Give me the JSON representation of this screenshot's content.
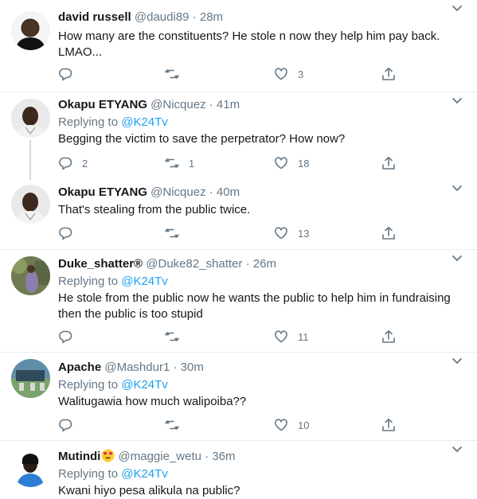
{
  "tweets": [
    {
      "name": "david russell",
      "badge": "",
      "emoji": false,
      "handle": "@daudi89",
      "time": "28m",
      "replying": "",
      "text": "How many are the constituents? He stole n now they help him pay back. LMAO...",
      "replies": "",
      "retweets": "",
      "likes": "3"
    },
    {
      "name": "Okapu ETYANG",
      "badge": "",
      "emoji": false,
      "handle": "@Nicquez",
      "time": "41m",
      "replying": "@K24Tv",
      "text": "Begging the victim to save the perpetrator? How now?",
      "replies": "2",
      "retweets": "1",
      "likes": "18"
    },
    {
      "name": "Okapu ETYANG",
      "badge": "",
      "emoji": false,
      "handle": "@Nicquez",
      "time": "40m",
      "replying": "",
      "text": "That's stealing from the public twice.",
      "replies": "",
      "retweets": "",
      "likes": "13"
    },
    {
      "name": "Duke_shatter",
      "badge": "®",
      "emoji": false,
      "handle": "@Duke82_shatter",
      "time": "26m",
      "replying": "@K24Tv",
      "text": "He stole from the public now he wants the public to help him in fundraising then the public is too stupid",
      "replies": "",
      "retweets": "",
      "likes": "11"
    },
    {
      "name": "Apache",
      "badge": "",
      "emoji": false,
      "handle": "@Mashdur1",
      "time": "30m",
      "replying": "@K24Tv",
      "text": "Walitugawia how much walipoiba??",
      "replies": "",
      "retweets": "",
      "likes": "10"
    },
    {
      "name": "Mutindi",
      "badge": "",
      "emoji": true,
      "handle": "@maggie_wetu",
      "time": "36m",
      "replying": "@K24Tv",
      "text": "Kwani hiyo pesa alikula na public?",
      "replies": "",
      "retweets": "",
      "likes": ""
    }
  ],
  "labels": {
    "replying_prefix": "Replying to ",
    "separator": " · "
  },
  "colors": {
    "link": "#1da1f2",
    "muted": "#657786",
    "text": "#14171a",
    "divider": "#e6ecf0"
  }
}
